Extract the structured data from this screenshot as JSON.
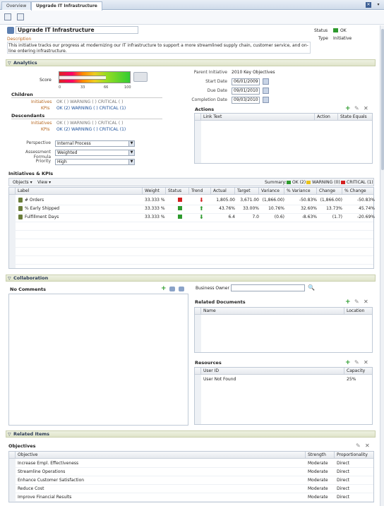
{
  "tabs": [
    {
      "label": "Overview"
    },
    {
      "label": "Upgrade IT Infrastructure"
    }
  ],
  "header": {
    "title": "Upgrade IT Infrastructure",
    "description_label": "Description",
    "description": "This initiative tracks our progress at modernizing our IT infrastructure to support a more streamlined supply chain, customer service, and on-line ordering infrastructure.",
    "status_label": "Status",
    "status_value": "OK",
    "type_label": "Type",
    "type_value": "Initiative"
  },
  "analytics": {
    "title": "Analytics",
    "score_label": "Score",
    "score_ticks": [
      "0",
      "33",
      "66",
      "100"
    ],
    "children_label": "Children",
    "children_initiatives_label": "Initiatives",
    "children_initiatives_value": "OK ( )  WARNING ( )  CRITICAL ( )",
    "children_kpis_label": "KPIs",
    "children_kpis_value": "OK (2)  WARNING ( )  CRITICAL (1)",
    "descendants_label": "Descendants",
    "desc_initiatives_label": "Initiatives",
    "desc_initiatives_value": "OK ( )  WARNING ( )  CRITICAL ( )",
    "desc_kpis_label": "KPIs",
    "desc_kpis_value": "OK (2)  WARNING ( )  CRITICAL (1)",
    "perspective_label": "Perspective",
    "perspective_value": "Internal Process",
    "assessment_label": "Assessment Formula",
    "assessment_value": "Weighted",
    "priority_label": "Priority",
    "priority_value": "High",
    "parent_initiative_label": "Parent Initiative",
    "parent_initiative_value": "2010 Key Objectives",
    "start_date_label": "Start Date",
    "start_date_value": "06/01/2009",
    "due_date_label": "Due Date",
    "due_date_value": "09/01/2010",
    "completion_date_label": "Completion Date",
    "completion_date_value": "09/03/2010",
    "actions_label": "Actions",
    "actions_columns": [
      "Link Text",
      "Action",
      "State Equals"
    ]
  },
  "initiatives_kpis": {
    "title": "Initiatives & KPIs",
    "objects_menu": "Objects",
    "view_menu": "View",
    "summary_label": "Summary:",
    "summary_ok": "OK (2)",
    "summary_warning": "WARNING (0)",
    "summary_critical": "CRITICAL (1)",
    "columns": [
      "Label",
      "Weight",
      "Status",
      "Trend",
      "Actual",
      "Target",
      "Variance",
      "% Variance",
      "Change",
      "% Change"
    ],
    "rows": [
      {
        "label": "# Orders",
        "weight": "33.333 %",
        "status": "red",
        "trend": "down-red",
        "actual": "1,805.00",
        "target": "3,671.00",
        "variance": "(1,866.00)",
        "pct_variance": "-50.83%",
        "change": "(1,866.00)",
        "pct_change": "-50.83%"
      },
      {
        "label": "% Early Shipped",
        "weight": "33.333 %",
        "status": "green",
        "trend": "up-green",
        "actual": "43.76%",
        "target": "33.00%",
        "variance": "10.76%",
        "pct_variance": "32.60%",
        "change": "13.73%",
        "pct_change": "45.74%"
      },
      {
        "label": "Fulfillment Days",
        "weight": "33.333 %",
        "status": "green",
        "trend": "down-green",
        "actual": "6.4",
        "target": "7.0",
        "variance": "(0.6)",
        "pct_variance": "-8.63%",
        "change": "(1.7)",
        "pct_change": "-20.69%"
      }
    ]
  },
  "collaboration": {
    "title": "Collaboration",
    "no_comments": "No Comments",
    "business_owner_label": "Business Owner",
    "business_owner_value": "",
    "related_docs_label": "Related Documents",
    "related_docs_columns": [
      "Name",
      "Location"
    ],
    "resources_label": "Resources",
    "resources_columns": [
      "User ID",
      "Capacity"
    ],
    "resources_rows": [
      {
        "user": "User Not Found",
        "capacity": "25%"
      }
    ]
  },
  "related_items": {
    "title": "Related Items",
    "objectives_label": "Objectives",
    "columns": [
      "Objective",
      "Strength",
      "Proportionality"
    ],
    "rows": [
      {
        "objective": "Increase Empl. Effectiveness",
        "strength": "Moderate",
        "prop": "Direct"
      },
      {
        "objective": "Streamline Operations",
        "strength": "Moderate",
        "prop": "Direct"
      },
      {
        "objective": "Enhance Customer Satisfaction",
        "strength": "Moderate",
        "prop": "Direct"
      },
      {
        "objective": "Reduce Cost",
        "strength": "Moderate",
        "prop": "Direct"
      },
      {
        "objective": "Improve Financial Results",
        "strength": "Moderate",
        "prop": "Direct"
      }
    ]
  },
  "colors": {
    "ok": "#2e9a2e",
    "critical": "#d42020",
    "warning": "#e8c21a",
    "header": "#2a3a55"
  }
}
